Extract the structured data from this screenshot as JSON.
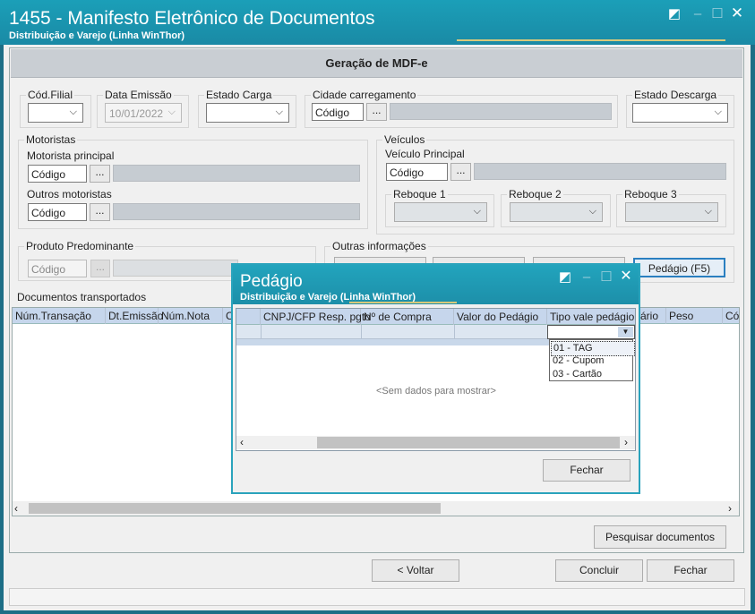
{
  "window": {
    "title": "1455 - Manifesto Eletrônico de Documentos",
    "subtitle": "Distribuição e Varejo (Linha WinThor)"
  },
  "form": {
    "header": "Geração de MDF-e",
    "cod_filial_label": "Cód.Filial",
    "data_emissao_label": "Data Emissão",
    "data_emissao_value": "10/01/2022",
    "estado_carga_label": "Estado Carga",
    "cidade_carregamento_label": "Cidade carregamento",
    "codigo_placeholder": "Código",
    "ellipsis": "...",
    "estado_descarga_label": "Estado Descarga",
    "motoristas_label": "Motoristas",
    "motorista_principal_label": "Motorista principal",
    "outros_motoristas_label": "Outros motoristas",
    "veiculos_label": "Veículos",
    "veiculo_principal_label": "Veículo Principal",
    "reboque1_label": "Reboque 1",
    "reboque2_label": "Reboque 2",
    "reboque3_label": "Reboque 3",
    "produto_label": "Produto Predominante",
    "outras_label": "Outras informações",
    "pedagio_button": "Pedágio (F5)"
  },
  "documents": {
    "label": "Documentos transportados",
    "columns": [
      "Núm.Transação",
      "Dt.Emissão",
      "Núm.Nota",
      "Cl",
      "ário",
      "Peso",
      "Có"
    ],
    "pesquisar_button": "Pesquisar documentos"
  },
  "footer": {
    "voltar": "< Voltar",
    "concluir": "Concluir",
    "fechar": "Fechar"
  },
  "dialog": {
    "title": "Pedágio",
    "subtitle": "Distribuição e Varejo (Linha WinThor)",
    "columns": [
      "CNPJ/CFP Resp. pgto",
      "Nº de Compra",
      "Valor do Pedágio",
      "Tipo vale pedágio"
    ],
    "empty": "<Sem dados para mostrar>",
    "options": [
      "01 - TAG",
      "02 - Cupom",
      "03 - Cartão"
    ],
    "fechar": "Fechar"
  },
  "colors": {
    "titlebar": "#1b9fb8",
    "grid_header": "#c6d6ec",
    "accent_border": "#2a7fc0"
  }
}
